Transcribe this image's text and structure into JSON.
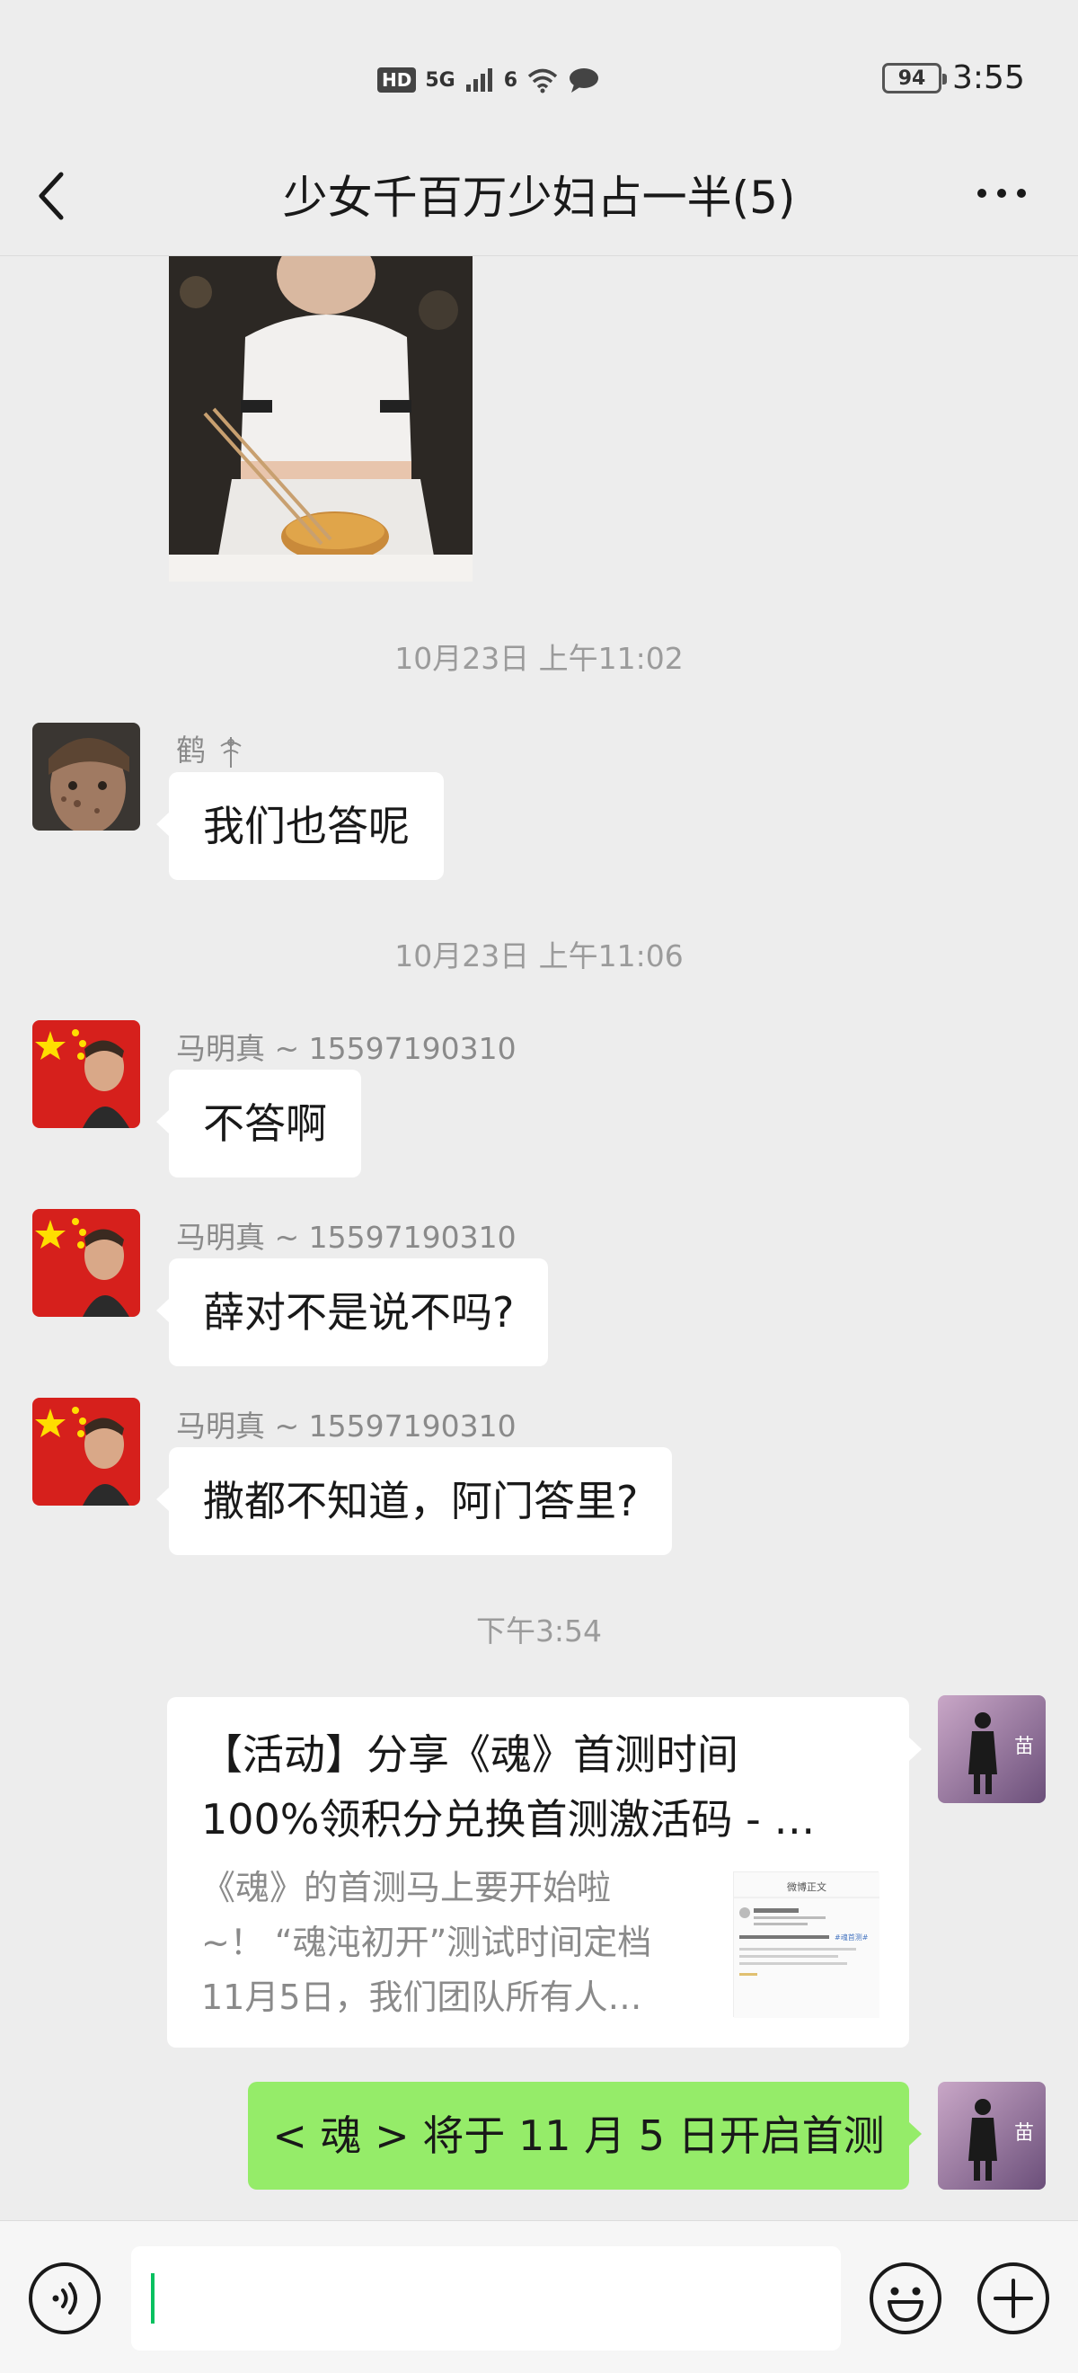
{
  "status_bar": {
    "hd": "HD",
    "network": "5G",
    "signal_slot": "6",
    "battery": "94",
    "time": "3:55"
  },
  "nav": {
    "title": "少女千百万少妇占一半(5)",
    "back_icon": "chevron-left-icon",
    "more_icon": "more-horizontal-icon"
  },
  "messages": {
    "image_message": {
      "type": "photo"
    },
    "time1": "10月23日 上午11:02",
    "msg1": {
      "sender": "鹤",
      "text": "我们也答呢"
    },
    "time2": "10月23日 上午11:06",
    "msg2": {
      "sender": "马明真 ~ 15597190310",
      "text": "不答啊"
    },
    "msg3": {
      "sender": "马明真 ~ 15597190310",
      "text": "薛对不是说不吗?"
    },
    "msg4": {
      "sender": "马明真 ~ 15597190310",
      "text": "撒都不知道，阿门答里?"
    },
    "time3": "下午3:54",
    "link_card": {
      "title_line1": "【活动】分享《魂》首测时间",
      "title_line2": "100%领积分兑换首测激活码 - …",
      "desc_line1": "《魂》的首测马上要开始啦",
      "desc_line2": "~！ “魂沌初开”测试时间定档",
      "desc_line3": "11月5日，我们团队所有人…",
      "thumb_title": "微博正文",
      "thumb_link": "#魂首测#"
    },
    "msg5": {
      "text": "< 魂 > 将于 11 月 5 日开启首测"
    },
    "self_avatar_glyph": "苗"
  },
  "input_bar": {
    "voice_icon": "voice-icon",
    "emoji_icon": "emoji-icon",
    "plus_icon": "plus-icon"
  },
  "colors": {
    "background": "#ededed",
    "bubble_self": "#95ec69",
    "bubble_other": "#ffffff",
    "accent": "#07c160"
  }
}
